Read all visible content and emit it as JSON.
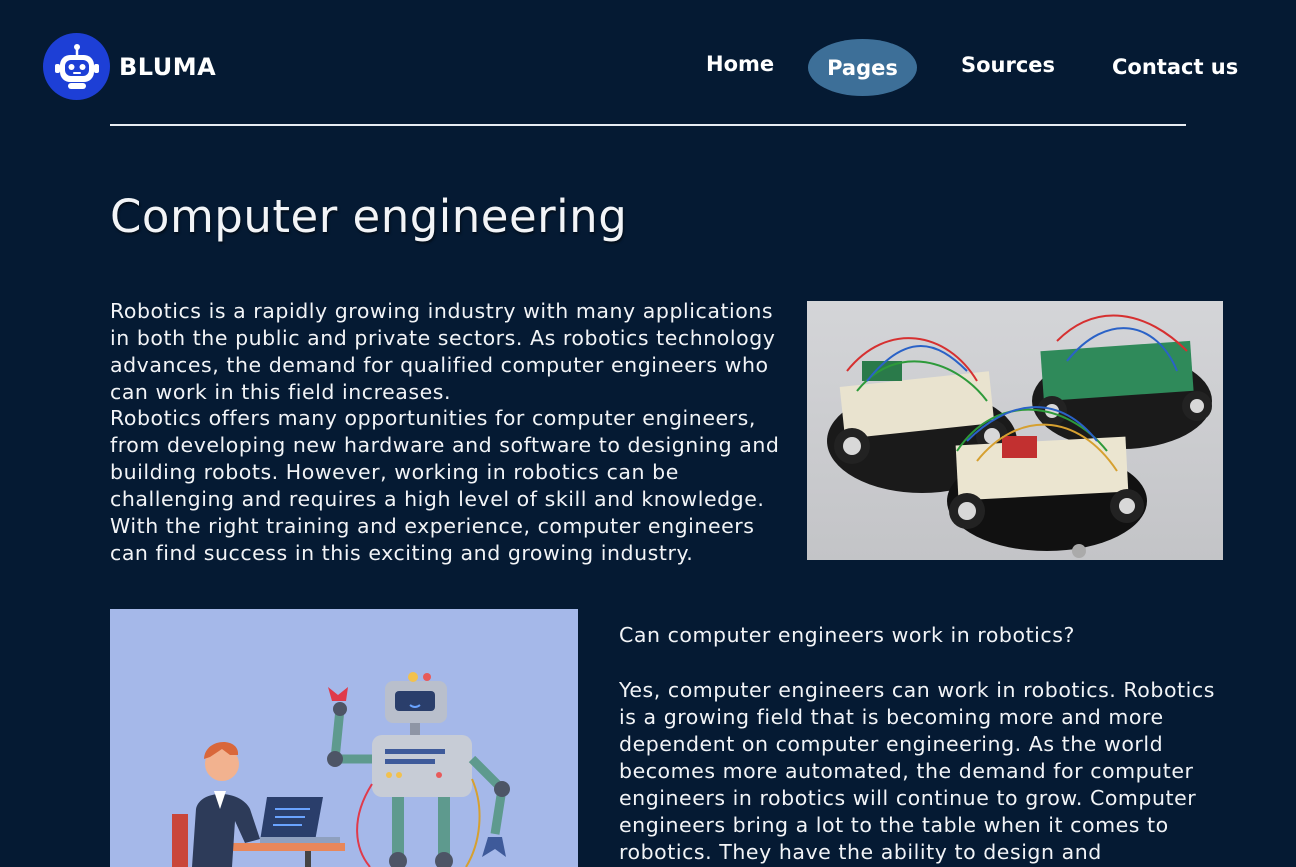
{
  "header": {
    "brand": "BLUMA",
    "nav": {
      "home": "Home",
      "pages": "Pages",
      "sources": "Sources",
      "contact": "Contact us"
    }
  },
  "main": {
    "title": "Computer engineering",
    "intro_p1": "Robotics is a rapidly growing industry with many applications in both the public and private sectors. As robotics technology advances, the demand for qualified computer engineers who can work in this field increases.",
    "intro_p2": "Robotics offers many opportunities for computer engineers, from developing new hardware and software to designing and building robots. However, working in robotics can be challenging and requires a high level of skill and knowledge. With the right training and experience, computer engineers can find success in this exciting and growing industry.",
    "question": "Can computer engineers work in robotics?",
    "answer": "Yes, computer engineers can work in robotics. Robotics is a growing field that is becoming more and more dependent on computer engineering. As the world becomes more automated, the demand for computer engineers in robotics will continue to grow. Computer engineers bring a lot to the table when it comes to robotics. They have the ability to design and"
  },
  "colors": {
    "background": "#051a33",
    "nav_active": "#3d6f98",
    "logo": "#1d3fd6",
    "illustration_bg": "#a5b8e9"
  },
  "icons": {
    "logo": "robot-head-icon"
  }
}
